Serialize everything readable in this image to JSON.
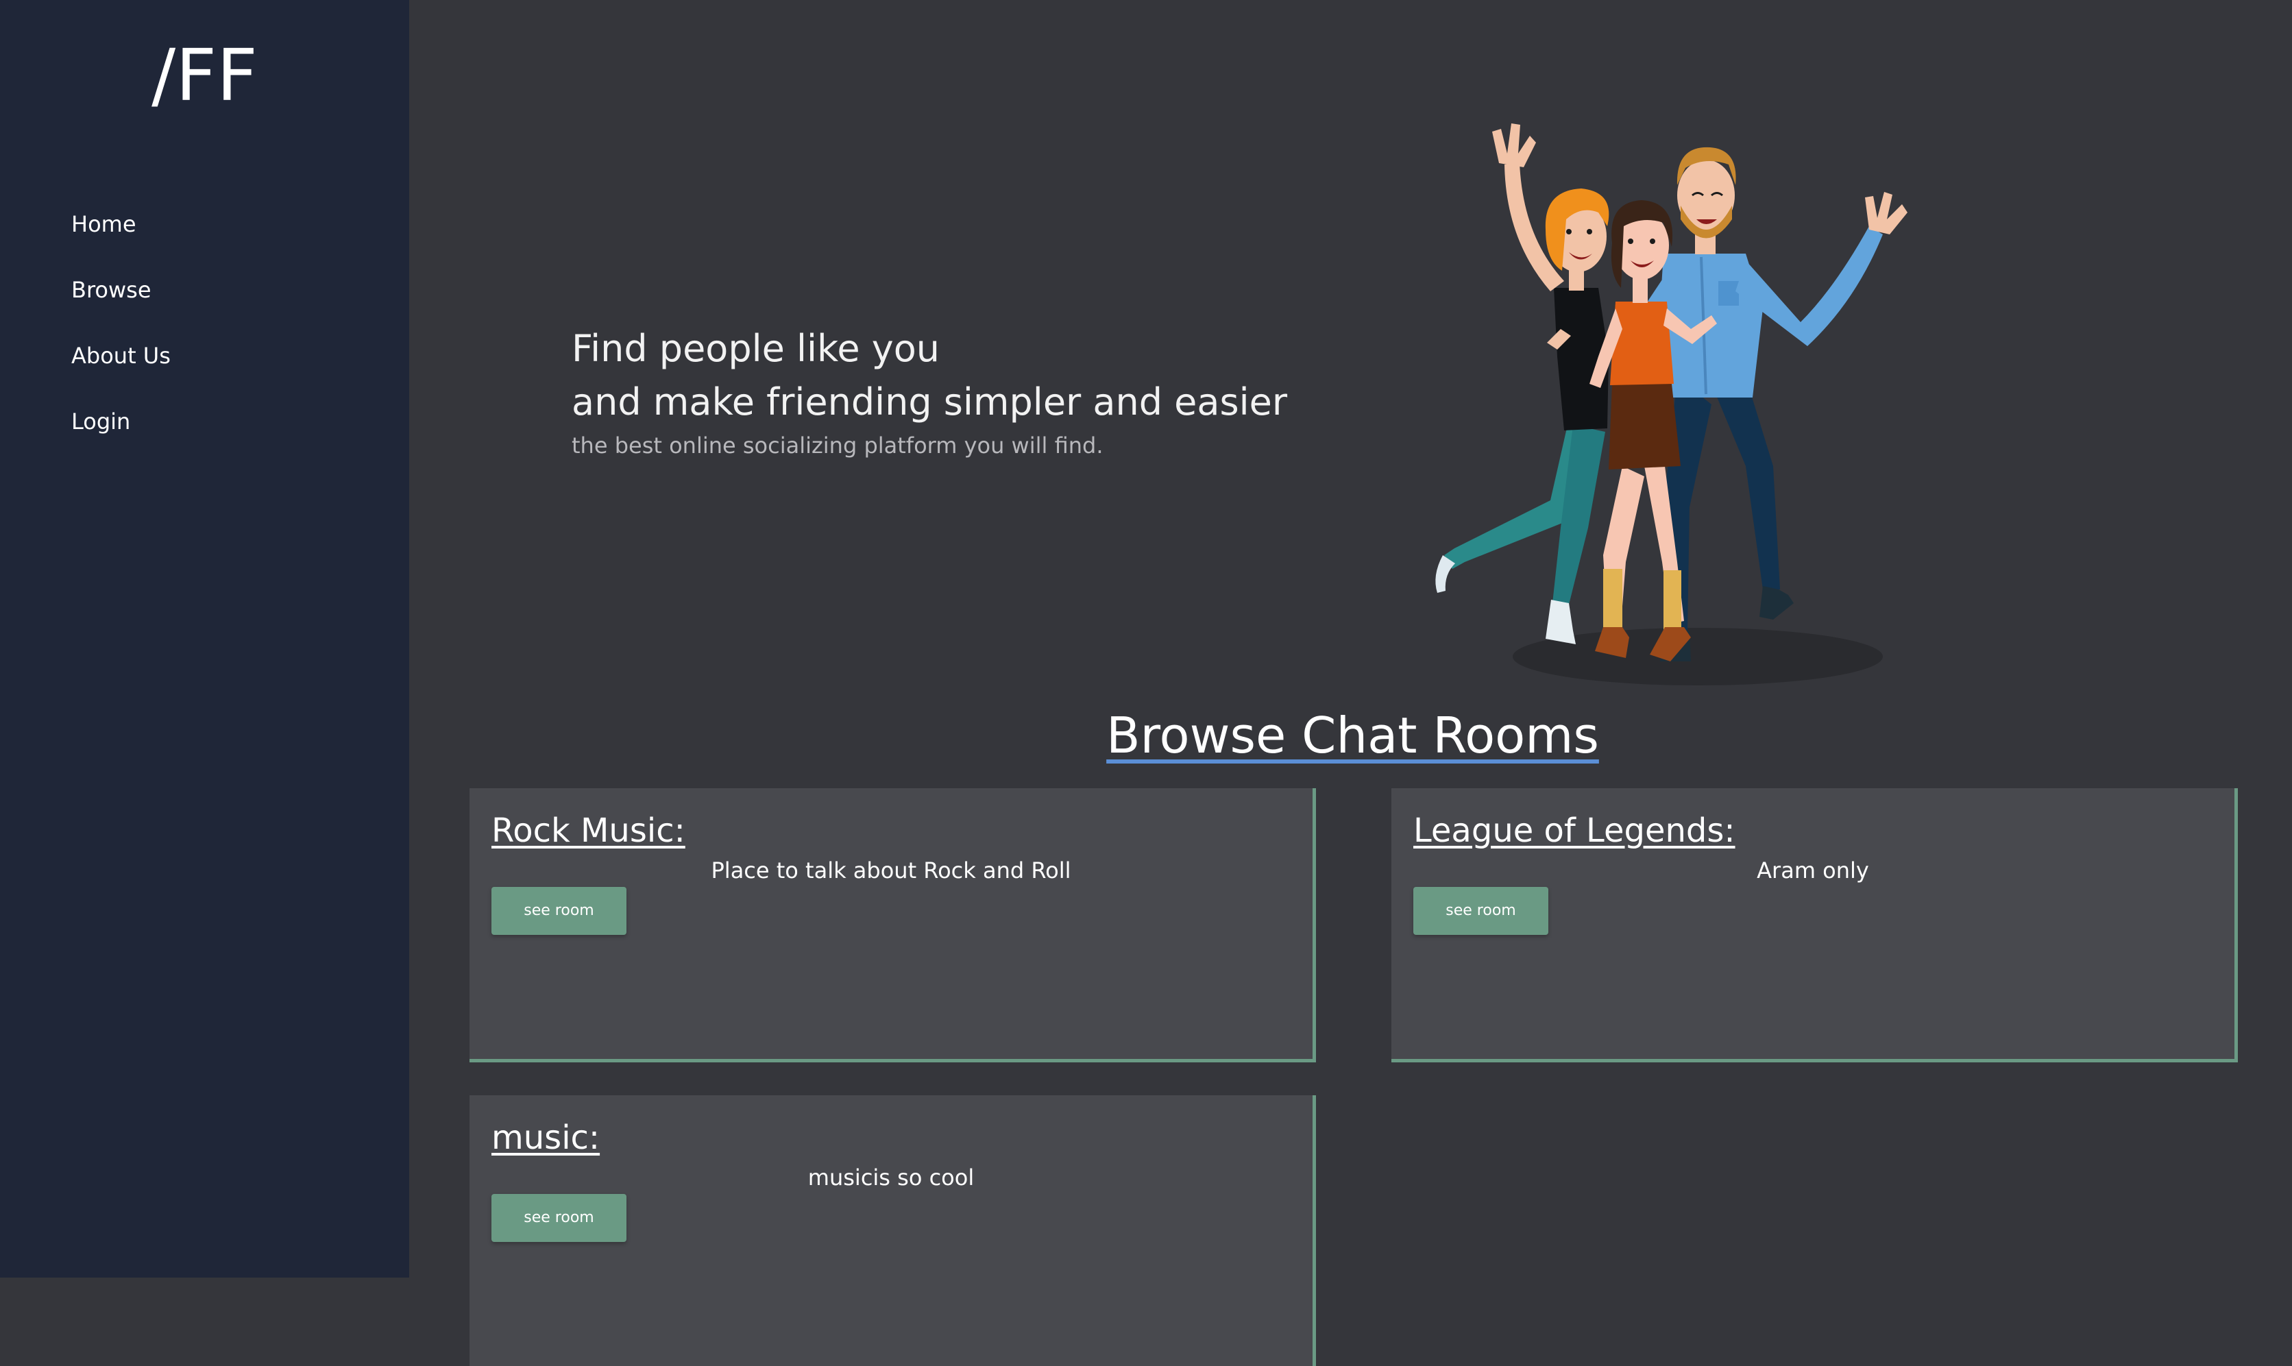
{
  "sidebar": {
    "logo": "/FF",
    "nav": [
      {
        "label": "Home"
      },
      {
        "label": "Browse"
      },
      {
        "label": "About Us"
      },
      {
        "label": "Login"
      }
    ]
  },
  "hero": {
    "title_line1": "Find people like you",
    "title_line2": "and make friending simpler and easier",
    "subtitle": "the best online socializing platform you will find."
  },
  "browse": {
    "title": "Browse Chat Rooms",
    "rooms": [
      {
        "name": "Rock Music:",
        "description": "Place to talk about Rock and Roll",
        "button": "see room"
      },
      {
        "name": "League of Legends:",
        "description": "Aram only",
        "button": "see room"
      },
      {
        "name": "music:",
        "description": "musicis so cool",
        "button": "see room"
      }
    ]
  },
  "colors": {
    "sidebar_bg": "#1f2638",
    "main_bg": "#35363b",
    "card_bg": "#48494e",
    "accent": "#6a9a84",
    "title_underline": "#5b8fd6"
  }
}
